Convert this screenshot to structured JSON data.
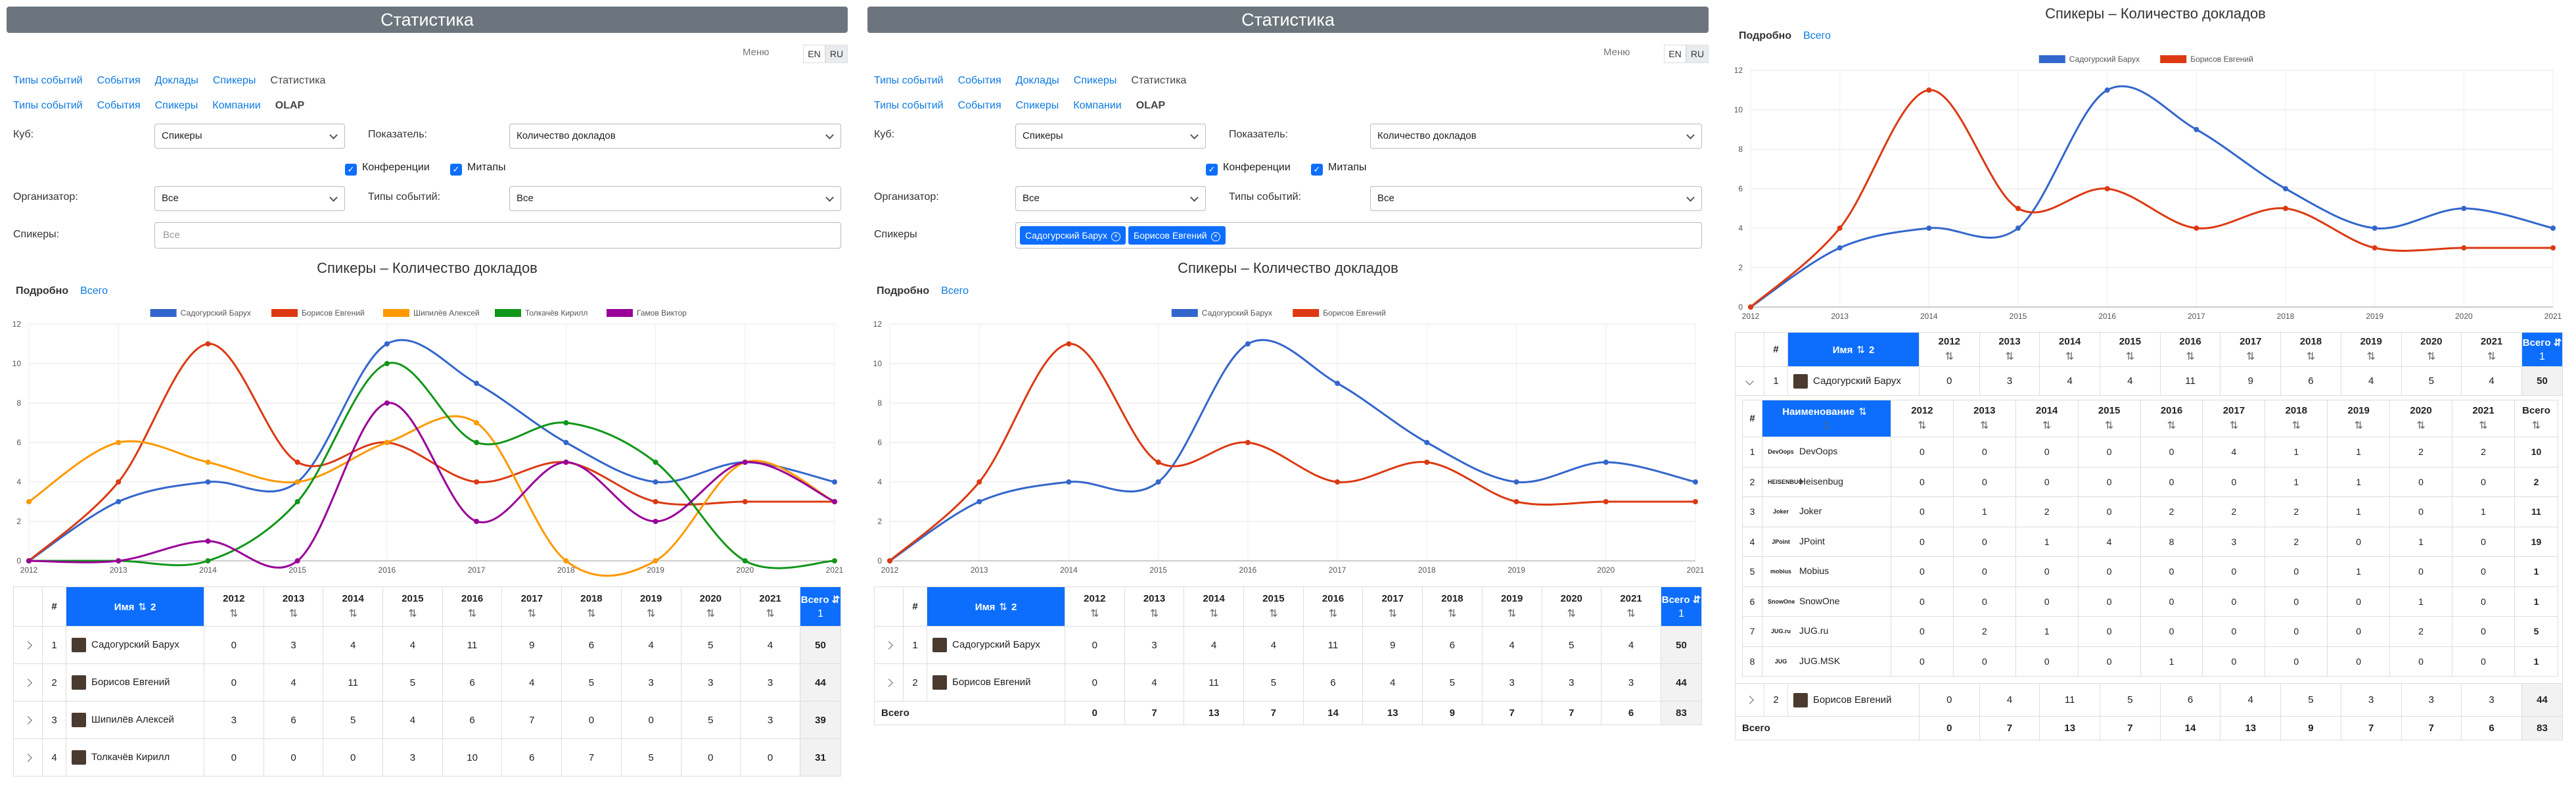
{
  "app_title": "Статистика",
  "menu_label": "Меню",
  "langs": [
    "EN",
    "RU"
  ],
  "nav1": [
    "Типы событий",
    "События",
    "Доклады",
    "Спикеры",
    "Статистика"
  ],
  "nav2": [
    "Типы событий",
    "События",
    "Спикеры",
    "Компании",
    "OLAP"
  ],
  "form": {
    "cube_label": "Куб:",
    "cube_value": "Спикеры",
    "metric_label": "Показатель:",
    "metric_value": "Количество докладов",
    "cb_conf": "Конференции",
    "cb_meetups": "Митапы",
    "org_label": "Организатор:",
    "org_value": "Все",
    "types_label": "Типы событий:",
    "types_value": "Все",
    "speakers_label_a": "Спикеры:",
    "speakers_label_b": "Спикеры",
    "speakers_placeholder": "Все",
    "tags": [
      "Садогурский Барух",
      "Борисов Евгений"
    ]
  },
  "chart_title": "Спикеры – Количество докладов",
  "toggle_detail": "Подробно",
  "toggle_total": "Всего",
  "colors": {
    "blue": "#3366cc",
    "red": "#dc3912",
    "orange": "#ff9900",
    "green": "#109618",
    "purple": "#990099",
    "accent": "#0d6efd"
  },
  "chart_data": [
    {
      "type": "line",
      "title": "Спикеры – Количество докладов",
      "x": [
        2012,
        2013,
        2014,
        2015,
        2016,
        2017,
        2018,
        2019,
        2020,
        2021
      ],
      "ylim": [
        0,
        12
      ],
      "yticks": [
        0,
        2,
        4,
        6,
        8,
        10,
        12
      ],
      "legend": "top",
      "series": [
        {
          "name": "Садогурский Барух",
          "color": "#3366cc",
          "values": [
            0,
            3,
            4,
            4,
            11,
            9,
            6,
            4,
            5,
            4
          ]
        },
        {
          "name": "Борисов Евгений",
          "color": "#dc3912",
          "values": [
            0,
            4,
            11,
            5,
            6,
            4,
            5,
            3,
            3,
            3
          ]
        },
        {
          "name": "Шипилёв Алексей",
          "color": "#ff9900",
          "values": [
            3,
            6,
            5,
            4,
            6,
            7,
            0,
            0,
            5,
            3
          ]
        },
        {
          "name": "Толкачёв Кирилл",
          "color": "#109618",
          "values": [
            0,
            0,
            0,
            3,
            10,
            6,
            7,
            5,
            0,
            0
          ]
        },
        {
          "name": "Гамов Виктор",
          "color": "#990099",
          "values": [
            0,
            0,
            1,
            0,
            8,
            2,
            5,
            2,
            5,
            3
          ]
        }
      ]
    },
    {
      "type": "line",
      "title": "Спикеры – Количество докладов",
      "x": [
        2012,
        2013,
        2014,
        2015,
        2016,
        2017,
        2018,
        2019,
        2020,
        2021
      ],
      "ylim": [
        0,
        12
      ],
      "yticks": [
        0,
        2,
        4,
        6,
        8,
        10,
        12
      ],
      "legend": "top",
      "series": [
        {
          "name": "Садогурский Барух",
          "color": "#3366cc",
          "values": [
            0,
            3,
            4,
            4,
            11,
            9,
            6,
            4,
            5,
            4
          ]
        },
        {
          "name": "Борисов Евгений",
          "color": "#dc3912",
          "values": [
            0,
            4,
            11,
            5,
            6,
            4,
            5,
            3,
            3,
            3
          ]
        }
      ]
    },
    {
      "type": "line",
      "title": "Спикеры – Количество докладов",
      "x": [
        2012,
        2013,
        2014,
        2015,
        2016,
        2017,
        2018,
        2019,
        2020,
        2021
      ],
      "ylim": [
        0,
        12
      ],
      "yticks": [
        0,
        2,
        4,
        6,
        8,
        10,
        12
      ],
      "legend": "top",
      "series": [
        {
          "name": "Садогурский Барух",
          "color": "#3366cc",
          "values": [
            0,
            3,
            4,
            4,
            11,
            9,
            6,
            4,
            5,
            4
          ]
        },
        {
          "name": "Борисов Евгений",
          "color": "#dc3912",
          "values": [
            0,
            4,
            11,
            5,
            6,
            4,
            5,
            3,
            3,
            3
          ]
        }
      ]
    }
  ],
  "table": {
    "hash": "#",
    "name_header": "Имя",
    "name_sort": "2",
    "sort_icon": "⇅",
    "sort_icon_desc": "⇵",
    "years": [
      "2012",
      "2013",
      "2014",
      "2015",
      "2016",
      "2017",
      "2018",
      "2019",
      "2020",
      "2021"
    ],
    "total_header": "Всего",
    "total_sort": "1",
    "rows_a": [
      {
        "n": "1",
        "name": "Садогурский Барух",
        "vals": [
          "0",
          "3",
          "4",
          "4",
          "11",
          "9",
          "6",
          "4",
          "5",
          "4"
        ],
        "total": "50"
      },
      {
        "n": "2",
        "name": "Борисов Евгений",
        "vals": [
          "0",
          "4",
          "11",
          "5",
          "6",
          "4",
          "5",
          "3",
          "3",
          "3"
        ],
        "total": "44"
      },
      {
        "n": "3",
        "name": "Шипилёв Алексей",
        "vals": [
          "3",
          "6",
          "5",
          "4",
          "6",
          "7",
          "0",
          "0",
          "5",
          "3"
        ],
        "total": "39"
      },
      {
        "n": "4",
        "name": "Толкачёв Кирилл",
        "vals": [
          "0",
          "0",
          "0",
          "3",
          "10",
          "6",
          "7",
          "5",
          "0",
          "0"
        ],
        "total": "31"
      }
    ],
    "sum_label": "Всего",
    "sum_vals": [
      "0",
      "7",
      "13",
      "7",
      "14",
      "13",
      "9",
      "7",
      "7",
      "6"
    ],
    "sum_total": "83",
    "sub": {
      "hash": "#",
      "name_header": "Наименование",
      "name_sort": "1",
      "total_header": "Всего",
      "rows": [
        {
          "n": "1",
          "logo": "DevOops",
          "name": "DevOops",
          "vals": [
            "0",
            "0",
            "0",
            "0",
            "0",
            "4",
            "1",
            "1",
            "2",
            "2"
          ],
          "total": "10"
        },
        {
          "n": "2",
          "logo": "HEISENBUG",
          "name": "Heisenbug",
          "vals": [
            "0",
            "0",
            "0",
            "0",
            "0",
            "0",
            "1",
            "1",
            "0",
            "0"
          ],
          "total": "2"
        },
        {
          "n": "3",
          "logo": "Joker",
          "name": "Joker",
          "vals": [
            "0",
            "1",
            "2",
            "0",
            "2",
            "2",
            "2",
            "1",
            "0",
            "1"
          ],
          "total": "11"
        },
        {
          "n": "4",
          "logo": "JPoint",
          "name": "JPoint",
          "vals": [
            "0",
            "0",
            "1",
            "4",
            "8",
            "3",
            "2",
            "0",
            "1",
            "0"
          ],
          "total": "19"
        },
        {
          "n": "5",
          "logo": "mobius",
          "name": "Mobius",
          "vals": [
            "0",
            "0",
            "0",
            "0",
            "0",
            "0",
            "0",
            "1",
            "0",
            "0"
          ],
          "total": "1"
        },
        {
          "n": "6",
          "logo": "SnowOne",
          "name": "SnowOne",
          "vals": [
            "0",
            "0",
            "0",
            "0",
            "0",
            "0",
            "0",
            "0",
            "1",
            "0"
          ],
          "total": "1"
        },
        {
          "n": "7",
          "logo": "JUG.ru",
          "name": "JUG.ru",
          "vals": [
            "0",
            "2",
            "1",
            "0",
            "0",
            "0",
            "0",
            "0",
            "2",
            "0"
          ],
          "total": "5"
        },
        {
          "n": "8",
          "logo": "JUG",
          "name": "JUG.MSK",
          "vals": [
            "0",
            "0",
            "0",
            "0",
            "1",
            "0",
            "0",
            "0",
            "0",
            "0"
          ],
          "total": "1"
        }
      ]
    }
  }
}
